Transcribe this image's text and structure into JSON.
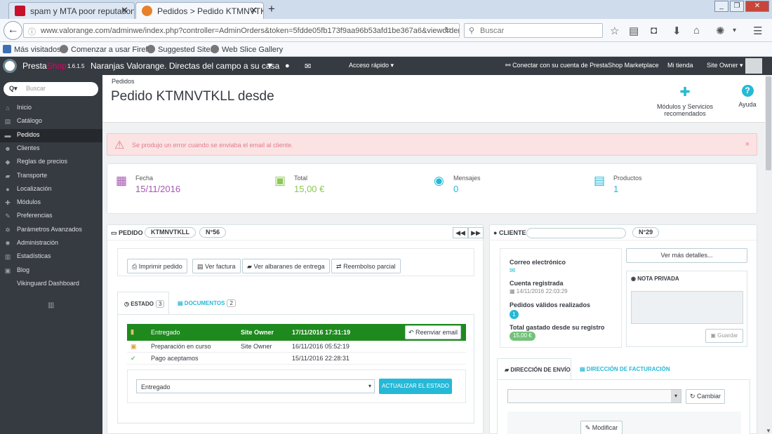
{
  "browser": {
    "tabs": [
      {
        "title": "spam y MTA poor reputation",
        "active": false
      },
      {
        "title": "Pedidos > Pedido KTMNVTKLL...",
        "active": true
      }
    ],
    "url": "www.valorange.com/adminwe/index.php?controller=AdminOrders&token=5fdde05fb173f9aa96b53afd1be367a6&vieworder&id_c",
    "search_placeholder": "Buscar",
    "bookmarks": [
      "Más visitados",
      "Comenzar a usar Firef...",
      "Suggested Sites",
      "Web Slice Gallery"
    ]
  },
  "ps_header": {
    "logo_a": "Presta",
    "logo_b": "Shop",
    "version": "1.6.1.5",
    "shop_name": "Naranjas Valorange. Directas del campo a su casa",
    "quick_access": "Acceso rápido",
    "marketplace": "Conectar con su cuenta de PrestaShop Marketplace",
    "my_shop": "Mi tienda",
    "owner": "Site Owner"
  },
  "sidebar": {
    "search_placeholder": "Buscar",
    "items": [
      {
        "label": "Inicio",
        "icon": "home-icon",
        "glyph": "⌂"
      },
      {
        "label": "Catálogo",
        "icon": "catalog-icon",
        "glyph": "▤"
      },
      {
        "label": "Pedidos",
        "icon": "orders-icon",
        "glyph": "▬",
        "active": true
      },
      {
        "label": "Clientes",
        "icon": "customers-icon",
        "glyph": "☻"
      },
      {
        "label": "Reglas de precios",
        "icon": "tag-icon",
        "glyph": "◆"
      },
      {
        "label": "Transporte",
        "icon": "truck-icon",
        "glyph": "▰"
      },
      {
        "label": "Localización",
        "icon": "globe-icon",
        "glyph": "●"
      },
      {
        "label": "Módulos",
        "icon": "puzzle-icon",
        "glyph": "✚"
      },
      {
        "label": "Preferencias",
        "icon": "wrench-icon",
        "glyph": "✎"
      },
      {
        "label": "Parámetros Avanzados",
        "icon": "cogs-icon",
        "glyph": "✲"
      },
      {
        "label": "Administración",
        "icon": "cog-icon",
        "glyph": "✹"
      },
      {
        "label": "Estadísticas",
        "icon": "stats-icon",
        "glyph": "▥"
      },
      {
        "label": "Blog",
        "icon": "blog-icon",
        "glyph": "▣"
      },
      {
        "label": "Vikinguard Dashboard",
        "icon": "",
        "glyph": ""
      }
    ]
  },
  "page": {
    "breadcrumb": "Pedidos",
    "title": "Pedido KTMNVTKLL desde",
    "toolbar": [
      {
        "label": "Módulos y Servicios recomendados",
        "icon": "puzzle-icon"
      },
      {
        "label": "Ayuda",
        "icon": "help-icon"
      }
    ]
  },
  "alert": {
    "text": "Se produjo un error cuando se enviaba el email al cliente.",
    "close": "×"
  },
  "kpis": [
    {
      "label": "Fecha",
      "value": "15/11/2016",
      "color": "#a459b2",
      "icon": "calendar-icon"
    },
    {
      "label": "Total",
      "value": "15,00 €",
      "color": "#8bc954",
      "icon": "money-icon"
    },
    {
      "label": "Mensajes",
      "value": "0",
      "color": "#25b9d7",
      "icon": "comments-icon"
    },
    {
      "label": "Productos",
      "value": "1",
      "color": "#25b9d7",
      "icon": "book-icon"
    }
  ],
  "order": {
    "header_label": "PEDIDO",
    "reference": "KTMNVTKLL",
    "number": "N°56",
    "actions": [
      "Imprimir pedido",
      "Ver factura",
      "Ver albaranes de entrega",
      "Reembolso parcial"
    ],
    "tabs": [
      {
        "label": "ESTADO",
        "count": "3"
      },
      {
        "label": "DOCUMENTOS",
        "count": "2"
      }
    ],
    "history": [
      {
        "status": "Entregado",
        "employee": "Site Owner",
        "date": "17/11/2016 17:31:19",
        "current": true
      },
      {
        "status": "Preparación en curso",
        "employee": "Site Owner",
        "date": "16/11/2016 05:52:19"
      },
      {
        "status": "Pago aceptamos",
        "employee": "",
        "date": "15/11/2016 22:28:31"
      }
    ],
    "resend_label": "Reenviar email",
    "status_select": "Entregado",
    "update_label": "ACTUALIZAR EL ESTADO"
  },
  "customer": {
    "header_label": "CLIENTE",
    "number": "N°29",
    "view_details": "Ver más detalles...",
    "email_label": "Correo electrónico",
    "account_label": "Cuenta registrada",
    "account_date": "14/11/2016 22:03:29",
    "valid_orders_label": "Pedidos válidos realizados",
    "valid_orders": "1",
    "total_spent_label": "Total gastado desde su registro",
    "total_spent": "15,00 €",
    "private_note_label": "NOTA PRIVADA",
    "save_label": "Guardar",
    "address_tabs": [
      "DIRECCIÓN DE ENVÍO",
      "DIRECCIÓN DE FACTURACIÓN"
    ],
    "change_label": "Cambiar",
    "modify_label": "Modificar"
  }
}
